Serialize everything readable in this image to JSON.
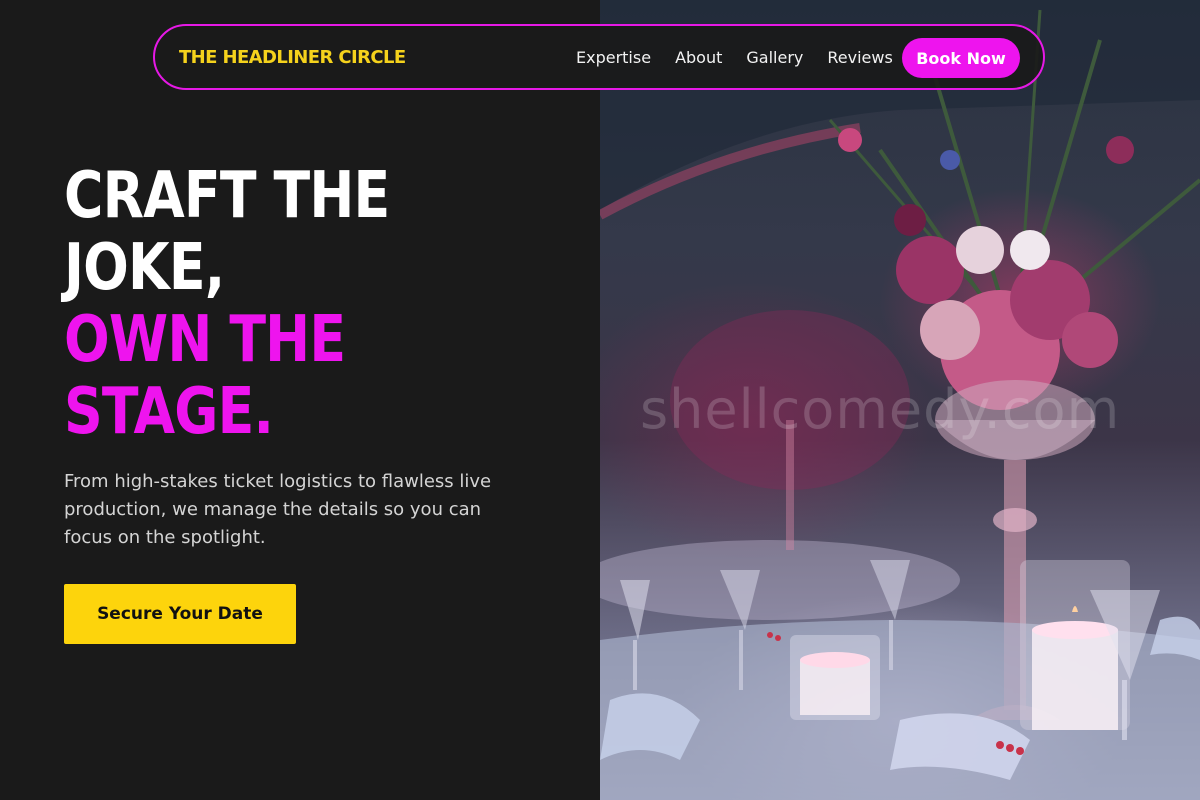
{
  "nav": {
    "brand": "THE HEADLINER CIRCLE",
    "links": [
      "Expertise",
      "About",
      "Gallery",
      "Reviews"
    ],
    "cta_label": "Book Now"
  },
  "hero": {
    "headline_white": [
      "CRAFT THE",
      "JOKE,"
    ],
    "headline_accent": [
      "OWN THE",
      "STAGE."
    ],
    "subtext": "From high-stakes ticket logistics to flawless live production, we manage the details so you can focus on the spotlight.",
    "cta_label": "Secure Your Date"
  },
  "photo": {
    "watermark": "shellcomedy.com",
    "subject": "event-banquet-table-with-floral-centerpiece"
  },
  "colors": {
    "background": "#1a1a1a",
    "accent_pink": "#ee14ee",
    "brand_yellow": "#f5d21c",
    "cta_yellow": "#fdd40c",
    "text_light": "#d4d4d4"
  }
}
